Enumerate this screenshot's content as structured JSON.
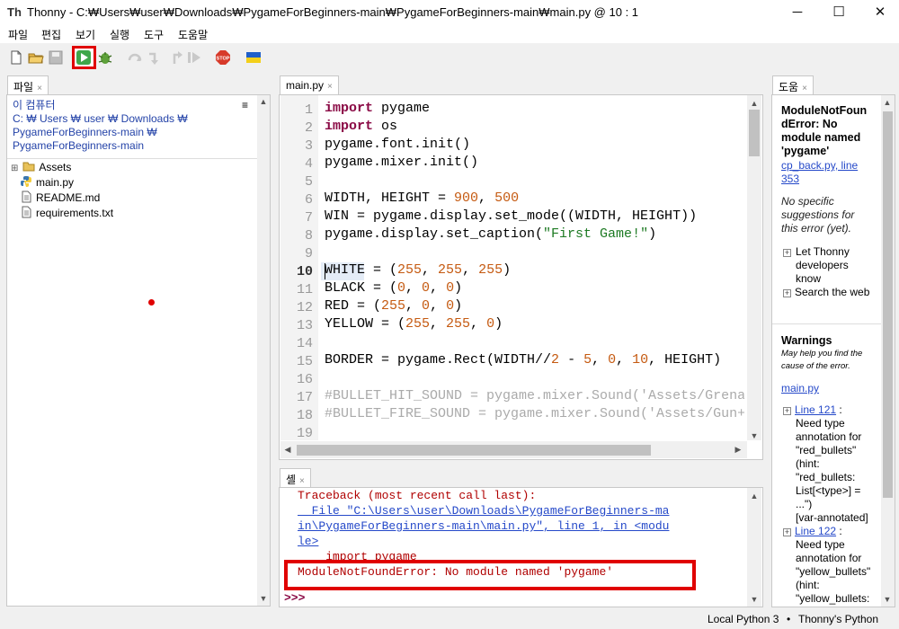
{
  "window": {
    "app_name": "Thonny",
    "title": "Thonny  -  C:₩Users₩user₩Downloads₩PygameForBeginners-main₩PygameForBeginners-main₩main.py  @  10 : 1",
    "minimize": "─",
    "maximize": "☐",
    "close": "✕"
  },
  "menu": [
    "파일",
    "편집",
    "보기",
    "실행",
    "도구",
    "도움말"
  ],
  "toolbar": {
    "icons": [
      "new-file-icon",
      "open-file-icon",
      "save-icon",
      "run-icon",
      "debug-icon",
      "step-over-icon",
      "step-into-icon",
      "step-out-icon",
      "resume-icon",
      "stop-icon",
      "ukraine-flag-icon"
    ],
    "stop_label": "STOP"
  },
  "files_panel": {
    "tab": "파일",
    "close": "×",
    "menu_glyph": "≡",
    "path_lines": [
      "이 컴퓨터",
      "C: ₩ Users ₩ user ₩ Downloads ₩",
      "PygameForBeginners-main ₩",
      "PygameForBeginners-main"
    ],
    "items": [
      {
        "name": "Assets",
        "type": "folder",
        "expander": "⊞"
      },
      {
        "name": "main.py",
        "type": "python"
      },
      {
        "name": "README.md",
        "type": "file"
      },
      {
        "name": "requirements.txt",
        "type": "file"
      }
    ]
  },
  "editor": {
    "tab": "main.py",
    "close": "×",
    "line_numbers": [
      "1",
      "2",
      "3",
      "4",
      "5",
      "6",
      "7",
      "8",
      "9",
      "10",
      "11",
      "12",
      "13",
      "14",
      "15",
      "16",
      "17",
      "18",
      "19"
    ],
    "current_line": "10"
  },
  "shell": {
    "tab": "셸",
    "close": "×",
    "traceback_header": "Traceback (most recent call last):",
    "file_line_1": "  File \"C:\\Users\\user\\Downloads\\PygameForBeginners-ma",
    "file_line_2": "in\\PygameForBeginners-main\\main.py\", line 1, in <modu",
    "file_line_3": "le>",
    "source_line": "    import pygame",
    "error": "ModuleNotFoundError: No module named 'pygame'",
    "prompt": ">>>"
  },
  "help_panel": {
    "tab": "도움",
    "close": "×",
    "title_lines": [
      "ModuleNotFoun",
      "dError: No",
      "module named",
      "'pygame'"
    ],
    "location_link_lines": [
      "cp_back.py, line",
      "353"
    ],
    "no_suggestions_lines": [
      "No specific",
      "suggestions for",
      "this error (yet)."
    ],
    "let_thonny": [
      "Let Thonny",
      "developers",
      "know"
    ],
    "search_web": "Search the web",
    "warnings_title": "Warnings",
    "warnings_sub_lines": [
      "May help you find the",
      "cause of the error."
    ],
    "file_link": "main.py",
    "warning1_link": "Line 121",
    "warning1_lines": [
      "Need type",
      "annotation for",
      "\"red_bullets\"",
      "(hint:",
      "\"red_bullets:",
      "List[<type>] =",
      "...\")",
      "[var-annotated]"
    ],
    "warning2_link": "Line 122",
    "warning2_lines": [
      "Need type",
      "annotation for",
      "\"yellow_bullets\"",
      "(hint:",
      "\"yellow_bullets:"
    ],
    "colon": " :"
  },
  "status": {
    "interpreter": "Local Python 3",
    "separator": "•",
    "thonny_python": "Thonny's Python"
  },
  "colors": {
    "keyword": "#8a0a45",
    "number": "#c55a11",
    "string": "#1d7a23",
    "comment": "#aaaaaa",
    "error": "#b00000",
    "highlight_box": "#e00000"
  }
}
